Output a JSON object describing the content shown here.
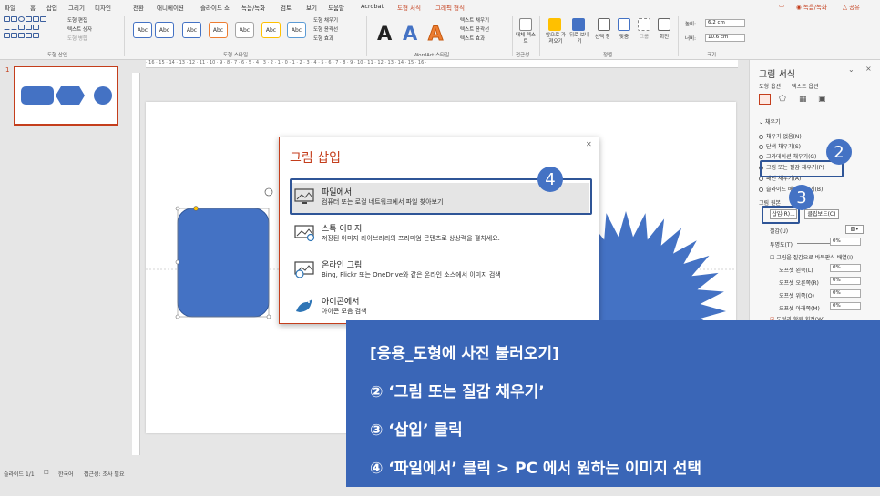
{
  "menu": {
    "tabs": [
      "파일",
      "홈",
      "삽입",
      "그리기",
      "디자인",
      "전환",
      "애니메이션",
      "슬라이드 쇼",
      "녹음/녹화",
      "검토",
      "보기",
      "도움말",
      "Acrobat",
      "도형 서식",
      "그래픽 형식"
    ],
    "record_button": "◉ 녹음/녹화",
    "share_button": "△ 공유"
  },
  "ribbon": {
    "groups": {
      "insert_shapes": "도형 삽입",
      "shape_styles": "도형 스타일",
      "wordart_styles": "WordArt 스타일",
      "accessibility": "접근성",
      "arrange": "정렬",
      "size": "크기"
    },
    "edit_shape": "도형 편집",
    "text_box": "텍스트 상자",
    "merge_shapes": "도형 병합",
    "style_sample": "Abc",
    "shape_fill": "도형 채우기",
    "shape_outline": "도형 윤곽선",
    "shape_effects": "도형 효과",
    "text_fill": "텍스트 채우기",
    "text_outline": "텍스트 윤곽선",
    "text_effects": "텍스트 효과",
    "alt_text": "대체 텍스트",
    "bring_forward": "앞으로 가져오기",
    "send_backward": "뒤로 보내기",
    "selection_pane": "선택 창",
    "align": "맞춤",
    "group": "그룹",
    "rotate": "회전",
    "height_label": "높이:",
    "height_value": "6.2 cm",
    "width_label": "너비:",
    "width_value": "10.6 cm",
    "wordart_letter": "A"
  },
  "thumbnail": {
    "slide_number": "1"
  },
  "ruler": {
    "ticks": "· 16 · 15 · 14 · 13 · 12 · 11 · 10 · 9 · 8 · 7 · 6 · 5 · 4 · 3 · 2 · 1 · 0 · 1 · 2 · 3 · 4 · 5 · 6 · 7 · 8 · 9 · 10 · 11 · 12 · 13 · 14 · 15 · 16 ·"
  },
  "status": {
    "slide": "슬라이드 1/1",
    "language": "한국어",
    "accessibility": "접근성: 조사 필요"
  },
  "pane": {
    "title": "그림 서식",
    "tab_shape": "도형 옵션",
    "tab_text": "텍스트 옵션",
    "section_fill": "채우기",
    "fill_none": "채우기 없음(N)",
    "fill_solid": "단색 채우기(S)",
    "fill_gradient": "그라데이션 채우기(G)",
    "fill_picture": "그림 또는 질감 채우기(P)",
    "fill_pattern": "패턴 채우기(A)",
    "fill_slide": "슬라이드 배경 채우기(B)",
    "picture_source": "그림 원본",
    "insert_btn": "삽입(R)...",
    "clipboard_btn": "클립보드(C)",
    "texture": "질감(U)",
    "transparency": "투명도(T)",
    "transparency_value": "0%",
    "tile": "그림을 질감으로 바둑판식 배열(I)",
    "offset_left": "오프셋 왼쪽(L)",
    "offset_right": "오프셋 오른쪽(R)",
    "offset_top": "오프셋 위쪽(O)",
    "offset_bottom": "오프셋 아래쪽(M)",
    "offset_value": "0%",
    "rotate_with_shape": "도형과 함께 회전(W)"
  },
  "dialog": {
    "title": "그림 삽입",
    "items": [
      {
        "title": "파일에서",
        "desc": "컴퓨터 또는 로컬 네트워크에서 파일 찾아보기"
      },
      {
        "title": "스톡 이미지",
        "desc": "저장된 이미지 라이브러리의 프리미엄 콘텐츠로 상상력을 펼치세요."
      },
      {
        "title": "온라인 그림",
        "desc": "Bing, Flickr 또는 OneDrive와 같은 온라인 소스에서 이미지 검색"
      },
      {
        "title": "아이콘에서",
        "desc": "아이콘 모음 검색"
      }
    ]
  },
  "callouts": {
    "step2": "2",
    "step3": "3",
    "step4": "4"
  },
  "instructions": {
    "title": "[응용_도형에 사진 불러오기]",
    "step2": "② ‘그림 또는 질감 채우기’",
    "step3": "③ ‘삽입’ 클릭",
    "step4": "④ ‘파일에서’ 클릭 > PC 에서 원하는 이미지 선택"
  },
  "colors": {
    "accent": "#c43e1c",
    "shape_blue": "#4472c4",
    "panel_blue": "#3a66b7",
    "outline": "#2f5597"
  }
}
